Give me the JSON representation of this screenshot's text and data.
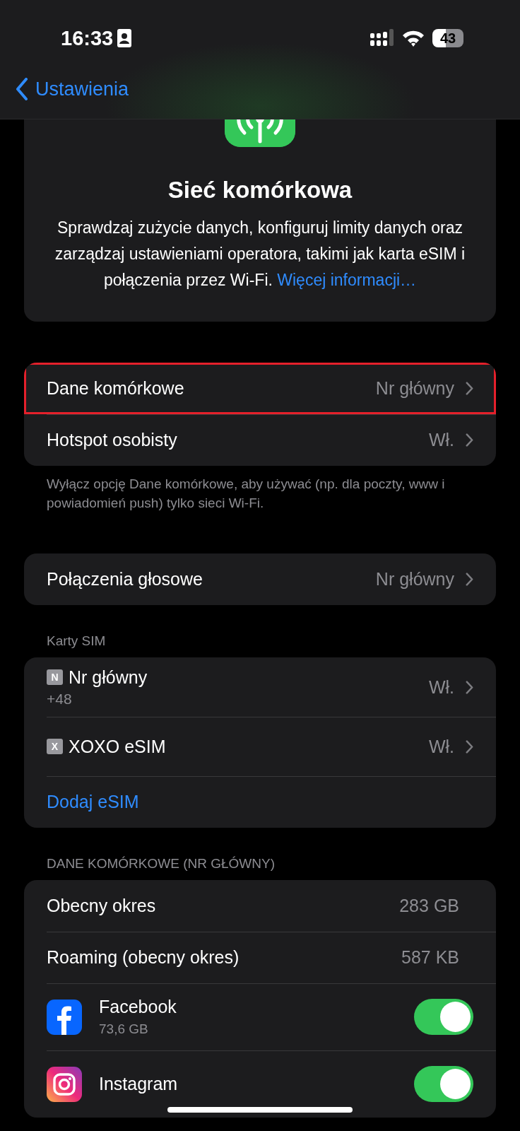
{
  "status_bar": {
    "time": "16:33",
    "battery": "43"
  },
  "nav": {
    "back": "Ustawienia"
  },
  "header": {
    "title": "Sieć komórkowa",
    "description": "Sprawdzaj zużycie danych, konfiguruj limity danych oraz zarządzaj ustawieniami operatora, takimi jak karta eSIM i połączenia przez Wi-Fi.",
    "link": "Więcej informacji…"
  },
  "sections": [
    {
      "rows": [
        {
          "kind": "nav",
          "label": "Dane komórkowe",
          "value": "Nr główny",
          "highlighted": true
        },
        {
          "kind": "nav",
          "label": "Hotspot osobisty",
          "value": "Wł.",
          "highlighted": false
        }
      ],
      "footer": "Wyłącz opcję Dane komórkowe, aby używać (np. dla poczty, www i powiadomień push) tylko sieci Wi-Fi."
    },
    {
      "rows": [
        {
          "kind": "nav",
          "label": "Połączenia głosowe",
          "value": "Nr główny",
          "highlighted": false
        }
      ]
    },
    {
      "header": "Karty SIM",
      "rows": [
        {
          "kind": "sim",
          "badge": "N",
          "label": "Nr główny",
          "subtitle": "+48",
          "value": "Wł."
        },
        {
          "kind": "sim",
          "badge": "X",
          "label": "XOXO eSIM",
          "value": "Wł."
        },
        {
          "kind": "action",
          "label": "Dodaj eSIM"
        }
      ]
    },
    {
      "header": "DANE KOMÓRKOWE (NR GŁÓWNY)",
      "rows": [
        {
          "kind": "stat",
          "label": "Obecny okres",
          "value": "283 GB"
        },
        {
          "kind": "stat",
          "label": "Roaming (obecny okres)",
          "value": "587 KB"
        },
        {
          "kind": "app",
          "label": "Facebook",
          "subtitle": "73,6 GB",
          "on": true
        },
        {
          "kind": "app",
          "label": "Instagram",
          "on": true
        }
      ]
    }
  ]
}
